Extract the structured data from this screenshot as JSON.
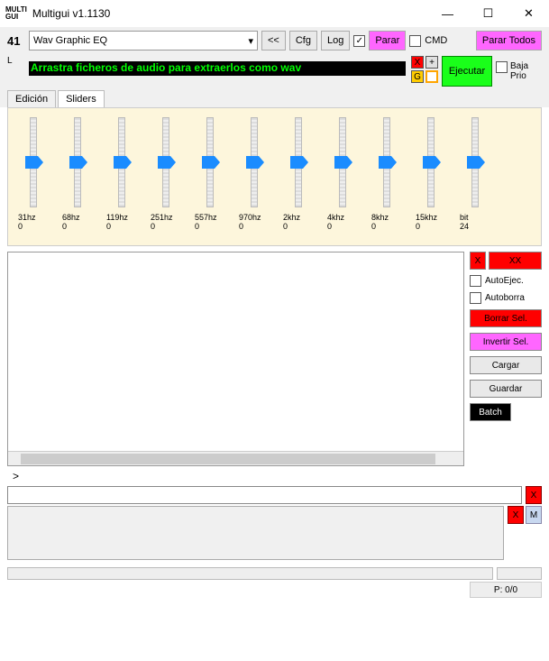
{
  "window": {
    "logo_top": "MULTI",
    "logo_bot": "GUI",
    "title": "Multigui v1.1130",
    "min": "—",
    "max": "☐",
    "close": "✕"
  },
  "toolbar": {
    "number": "41",
    "preset": "Wav Graphic EQ",
    "back": "<<",
    "cfg": "Cfg",
    "log": "Log",
    "log_checked": "✓",
    "parar": "Parar",
    "cmd": "CMD",
    "parar_todos": "Parar Todos"
  },
  "row2": {
    "l": "L",
    "banner": "Arrastra ficheros de audio para extraerlos como wav",
    "x": "X",
    "plus": "+",
    "g": "G",
    "ejecutar": "Ejecutar",
    "baja": "Baja",
    "prio": "Prio"
  },
  "tabs": {
    "edicion": "Edición",
    "sliders": "Sliders"
  },
  "sliders": [
    {
      "label": "31hz",
      "val": "0"
    },
    {
      "label": "68hz",
      "val": "0"
    },
    {
      "label": "119hz",
      "val": "0"
    },
    {
      "label": "251hz",
      "val": "0"
    },
    {
      "label": "557hz",
      "val": "0"
    },
    {
      "label": "970hz",
      "val": "0"
    },
    {
      "label": "2khz",
      "val": "0"
    },
    {
      "label": "4khz",
      "val": "0"
    },
    {
      "label": "8khz",
      "val": "0"
    },
    {
      "label": "15khz",
      "val": "0"
    },
    {
      "label": "bit",
      "val": "24"
    }
  ],
  "side": {
    "x": "X",
    "xx": "XX",
    "autoejec": "AutoEjec.",
    "autoborra": "Autoborra",
    "borrar": "Borrar Sel.",
    "invertir": "Invertir Sel.",
    "cargar": "Cargar",
    "guardar": "Guardar",
    "batch": "Batch"
  },
  "expand": ">",
  "bottom": {
    "x1": "X",
    "x2": "X",
    "m": "M"
  },
  "status": {
    "p": "P: 0/0"
  }
}
